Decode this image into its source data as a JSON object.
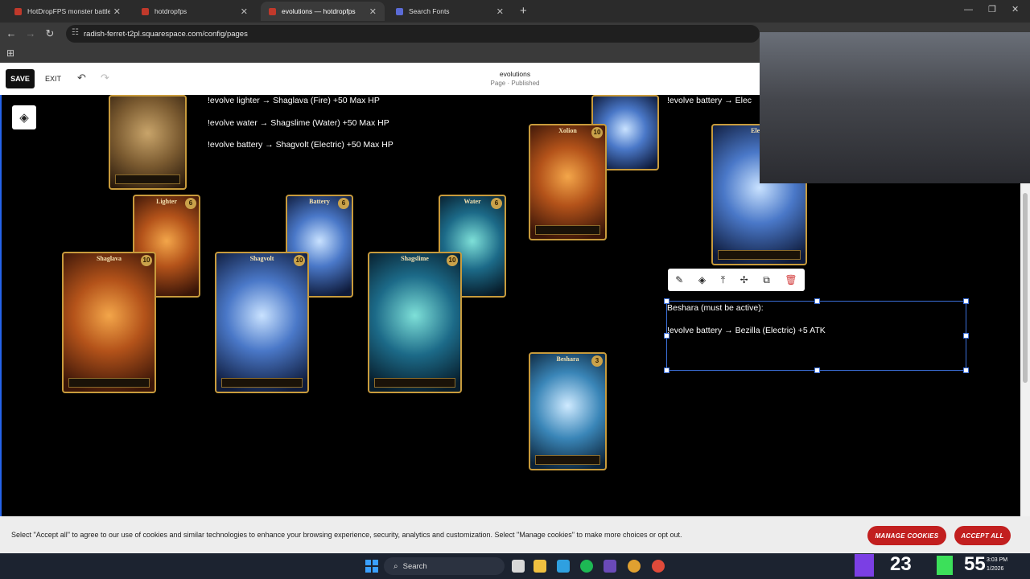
{
  "browser": {
    "tabs": [
      {
        "title": "HotDropFPS monster battle sty"
      },
      {
        "title": "hotdropfps"
      },
      {
        "title": "evolutions — hotdropfps"
      },
      {
        "title": "Search Fonts"
      }
    ],
    "new_tab": "+",
    "url": "radish-ferret-t2pl.squarespace.com/config/pages"
  },
  "editor": {
    "save_label": "SAVE",
    "exit_label": "EXIT",
    "page_title": "evolutions",
    "page_status": "Page · Published"
  },
  "content": {
    "commands_top": [
      "!evolve lighter → Shaglava (Fire) +50 Max HP",
      "!evolve water → Shagslime (Water) +50 Max HP",
      "!evolve battery → Shagvolt (Electric) +50 Max HP"
    ],
    "command_right": "!evolve battery → Elec",
    "selected_block": {
      "line1": "Beshara (must be active):",
      "line2": "!evolve battery → Bezilla (Electric) +5 ATK"
    },
    "cards": [
      {
        "name": "Lighter",
        "level": "6"
      },
      {
        "name": "Battery",
        "level": "6"
      },
      {
        "name": "Water",
        "level": "6"
      },
      {
        "name": "Shaglava",
        "level": "10"
      },
      {
        "name": "Shagvolt",
        "level": "10"
      },
      {
        "name": "Shagslime",
        "level": "10"
      },
      {
        "name": "Xolion",
        "level": "10"
      },
      {
        "name": "Electr",
        "level": ""
      },
      {
        "name": "Beshara",
        "level": "3"
      }
    ]
  },
  "cookie": {
    "text": "Select \"Accept all\" to agree to our use of cookies and similar technologies to enhance your browsing experience, security, analytics and customization. Select \"Manage cookies\" to make more choices or opt out.",
    "manage_label": "MANAGE COOKIES",
    "accept_label": "ACCEPT ALL"
  },
  "taskbar": {
    "search_label": "Search",
    "overlay_number_1": "23",
    "overlay_number_2": "55",
    "clock_time": "3:03 PM",
    "clock_date": "1/2026"
  },
  "colors": {
    "accent_blue": "#2563eb",
    "cookie_button": "#c21f1f",
    "card_border": "#c89b3c"
  },
  "icons": [
    "back-arrow-icon",
    "forward-arrow-icon",
    "reload-icon",
    "site-info-icon",
    "apps-grid-icon",
    "undo-icon",
    "redo-icon",
    "layers-icon",
    "pencil-icon",
    "paint-icon",
    "move-up-icon",
    "pin-icon",
    "duplicate-icon",
    "trash-icon",
    "windows-start-icon",
    "search-icon"
  ]
}
